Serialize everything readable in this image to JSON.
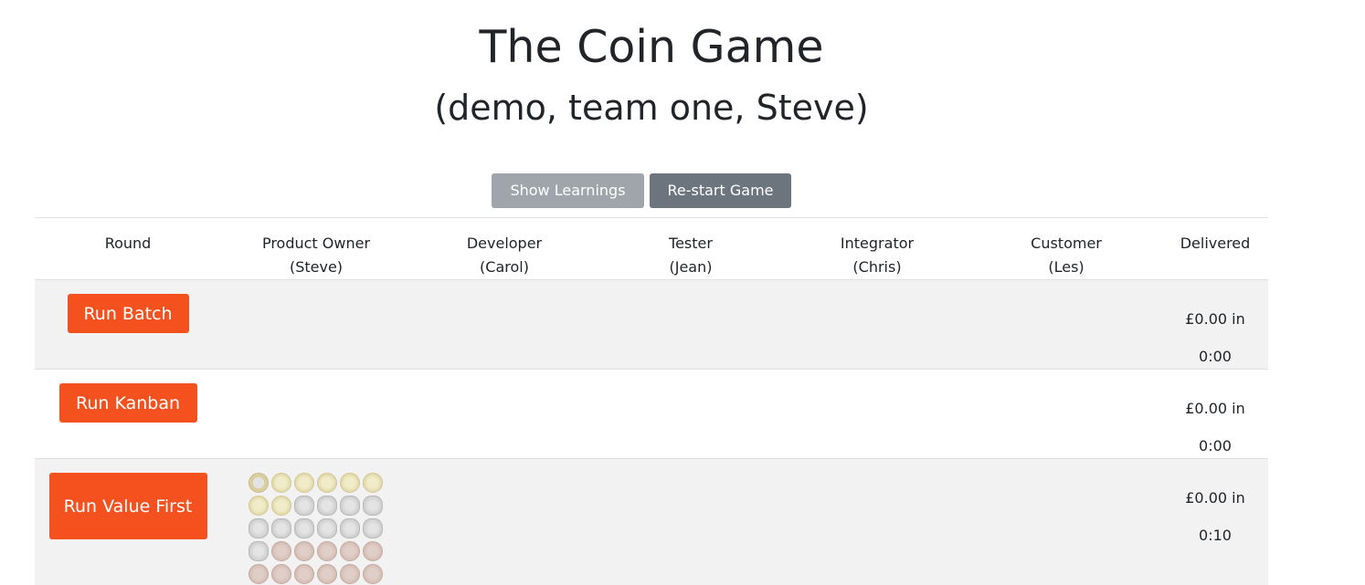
{
  "header": {
    "title": "The Coin Game",
    "subtitle": "(demo, team one, Steve)"
  },
  "controls": {
    "show_learnings_label": "Show Learnings",
    "restart_label": "Re-start Game"
  },
  "columns": [
    {
      "line1": "Round",
      "line2": ""
    },
    {
      "line1": "Product Owner",
      "line2": "(Steve)"
    },
    {
      "line1": "Developer",
      "line2": "(Carol)"
    },
    {
      "line1": "Tester",
      "line2": "(Jean)"
    },
    {
      "line1": "Integrator",
      "line2": "(Chris)"
    },
    {
      "line1": "Customer",
      "line2": "(Les)"
    },
    {
      "line1": "Delivered",
      "line2": ""
    }
  ],
  "rounds": [
    {
      "button_label": "Run Batch",
      "delivered_amount": "£0.00 in",
      "delivered_time": "0:00"
    },
    {
      "button_label": "Run Kanban",
      "delivered_amount": "£0.00 in",
      "delivered_time": "0:00"
    },
    {
      "button_label": "Run Value First",
      "delivered_amount": "£0.00 in",
      "delivered_time": "0:10"
    }
  ],
  "product_owner_coins": [
    "bimetal",
    "gold",
    "gold",
    "gold",
    "gold",
    "gold",
    "gold",
    "gold",
    "silver",
    "silver",
    "silver",
    "silver",
    "silver",
    "silver",
    "silver",
    "silver",
    "silver",
    "silver",
    "silver",
    "copper",
    "copper",
    "copper",
    "copper",
    "copper",
    "copper",
    "copper",
    "copper",
    "copper",
    "copper",
    "copper"
  ],
  "colors": {
    "run_button": "#f4511e",
    "secondary_light": "#9fa5aa",
    "secondary_dark": "#6c757d",
    "row_shade": "#f2f2f2"
  }
}
